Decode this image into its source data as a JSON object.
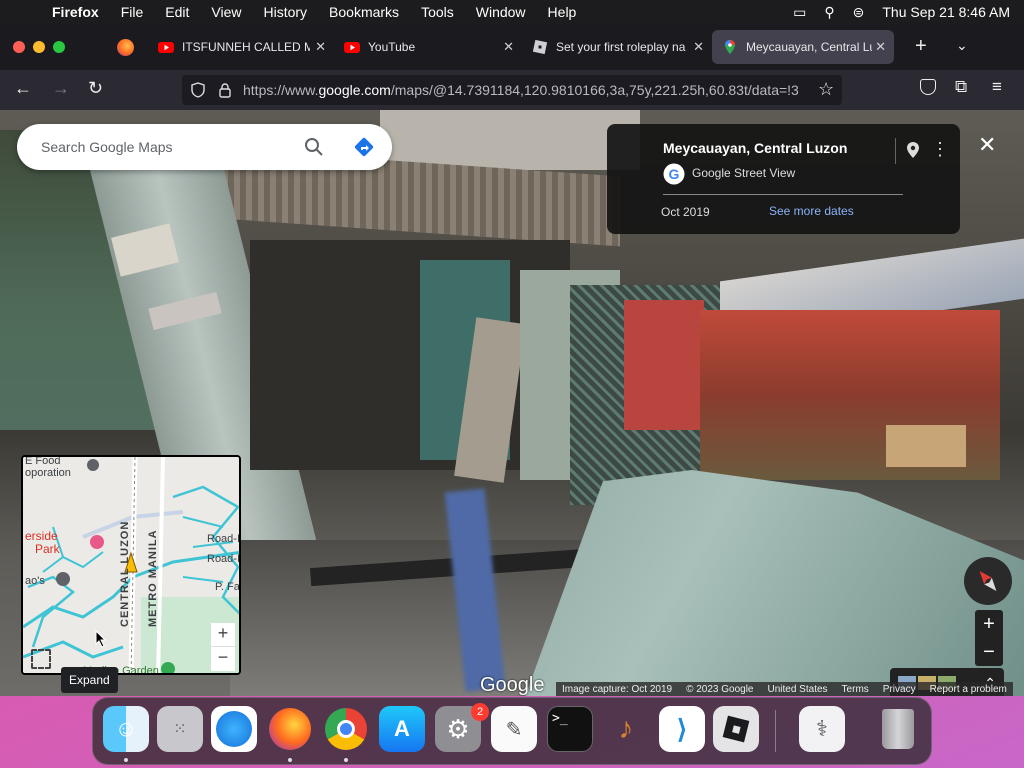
{
  "menubar": {
    "app": "Firefox",
    "items": [
      "File",
      "Edit",
      "View",
      "History",
      "Bookmarks",
      "Tools",
      "Window",
      "Help"
    ],
    "clock": "Thu Sep 21  8:46 AM"
  },
  "tabs": [
    {
      "title": "ITSFUNNEH CALLED ME",
      "favicon": "youtube-icon"
    },
    {
      "title": "YouTube",
      "favicon": "youtube-icon"
    },
    {
      "title": "Set your first roleplay na",
      "favicon": "roblox-icon"
    },
    {
      "title": "Meycauayan, Central Luz",
      "favicon": "google-maps-icon"
    }
  ],
  "url": {
    "prefix": "https://www.",
    "host": "google.com",
    "path": "/maps/@14.7391184,120.9810166,3a,75y,221.25h,60.83t/data=!3"
  },
  "search": {
    "placeholder": "Search Google Maps"
  },
  "infocard": {
    "title": "Meycauayan, Central Luzon",
    "source": "Google Street View",
    "date": "Oct 2019",
    "more_dates": "See more dates"
  },
  "minimap": {
    "labels": {
      "food": "E  Food",
      "food2": "oporation",
      "park1": "erside",
      "park2": "Park",
      "metro": "METRO MANILA",
      "central": "CENTRAL LUZON",
      "road1": "Road-II",
      "road2": "Road-II",
      "fav": "P. Fav",
      "aos": "ao's",
      "garden": "Marilao Garden"
    },
    "expand_label": "Expand"
  },
  "logo": "Google",
  "footer": {
    "capture": "Image capture: Oct 2019",
    "copyright": "© 2023 Google",
    "region": "United States",
    "terms": "Terms",
    "privacy": "Privacy",
    "report": "Report a problem"
  },
  "controls": {
    "zoom_in": "+",
    "zoom_out": "−"
  },
  "dock": {
    "apps": [
      "finder",
      "launchpad",
      "safari",
      "firefox",
      "chrome",
      "app-store",
      "system-settings",
      "textedit",
      "terminal",
      "garageband",
      "vscode",
      "roblox",
      "preview",
      "trash"
    ],
    "settings_badge": "2"
  },
  "colors": {
    "accent": "#1a73e8",
    "youtube": "#ff0000",
    "menubar": "#1c1c1e"
  }
}
